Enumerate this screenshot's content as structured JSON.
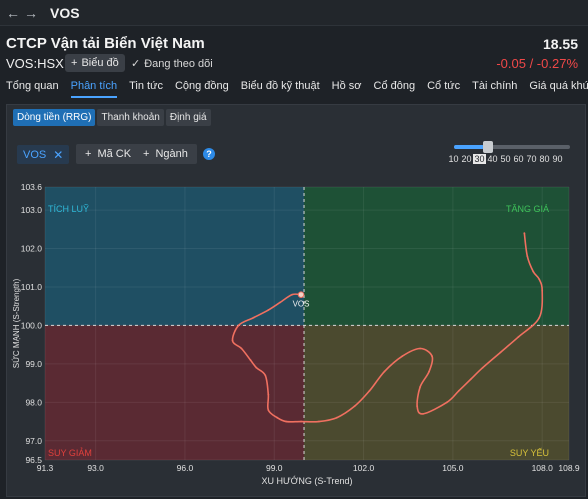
{
  "topbar": {
    "back_icon": "arrow-left-icon",
    "forward_icon": "arrow-right-icon",
    "symbol": "VOS"
  },
  "header": {
    "company": "CTCP Vận tải Biển Việt Nam",
    "price": "18.55",
    "ticker": "VOS:HSX",
    "chart_button": "Biểu đồ",
    "follow_label": "Đang theo dõi",
    "change": "-0.05 / -0.27%",
    "change_color": "#f04848"
  },
  "tabs": [
    "Tổng quan",
    "Phân tích",
    "Tin tức",
    "Cộng đồng",
    "Biểu đồ kỹ thuật",
    "Hồ sơ",
    "Cổ đông",
    "Cổ tức",
    "Tài chính",
    "Giá quá khứ"
  ],
  "active_tab": "Phân tích",
  "subtabs": [
    "Dòng tiền (RRG)",
    "Thanh khoản",
    "Định giá"
  ],
  "active_subtab": "Dòng tiền (RRG)",
  "filters": {
    "chip": "VOS",
    "add_stock": "Mã CK",
    "add_sector": "Ngành",
    "help": "?"
  },
  "period_slider": {
    "options": [
      "10",
      "20",
      "30",
      "40",
      "50",
      "60",
      "70",
      "80",
      "90"
    ],
    "selected": "30"
  },
  "chart_data": {
    "type": "scatter",
    "xlabel": "XU HƯỚNG (S-Trend)",
    "ylabel": "SỨC MẠNH (S-Strength)",
    "xlim": [
      91.3,
      108.9
    ],
    "ylim": [
      96.5,
      103.6
    ],
    "x_ticks": [
      "91.3",
      "93.0",
      "96.0",
      "99.0",
      "102.0",
      "105.0",
      "108.0",
      "108.9"
    ],
    "y_ticks": [
      "103.6",
      "103.0",
      "102.0",
      "101.0",
      "100.0",
      "99.0",
      "98.0",
      "97.0",
      "96.5"
    ],
    "x_tick_values": [
      91.3,
      93.0,
      96.0,
      99.0,
      102.0,
      105.0,
      108.0,
      108.9
    ],
    "y_tick_values": [
      103.6,
      103.0,
      102.0,
      101.0,
      100.0,
      99.0,
      98.0,
      97.0,
      96.5
    ],
    "center": [
      100,
      100
    ],
    "quadrants": {
      "top_left": {
        "label": "TÍCH LUỸ",
        "color": "#1f4f63",
        "label_color": "#2fb8d8"
      },
      "top_right": {
        "label": "TĂNG GIÁ",
        "color": "#1e5136",
        "label_color": "#3ec25a"
      },
      "bottom_left": {
        "label": "SUY GIẢM",
        "color": "#5a2a33",
        "label_color": "#e0403c"
      },
      "bottom_right": {
        "label": "SUY YẾU",
        "color": "#4b4a2f",
        "label_color": "#d8c23a"
      }
    },
    "series": [
      {
        "name": "VOS",
        "color": "#f07060",
        "x": [
          107.4,
          107.5,
          107.7,
          107.9,
          108.0,
          107.9,
          107.2,
          106.6,
          106.0,
          105.6,
          105.2,
          104.8,
          104.0,
          103.8,
          103.9,
          104.2,
          104.3,
          103.9,
          103.3,
          102.7,
          102.2,
          101.7,
          101.1,
          100.5,
          99.9,
          99.4,
          99.1,
          98.8,
          98.8,
          98.7,
          98.4,
          98.2,
          97.9,
          97.6,
          97.8,
          98.3,
          98.8,
          99.2,
          99.6,
          99.9
        ],
        "y": [
          102.4,
          101.8,
          101.4,
          101.2,
          100.9,
          100.2,
          99.7,
          99.3,
          98.9,
          98.6,
          98.3,
          98.0,
          97.7,
          97.9,
          98.4,
          98.8,
          99.2,
          99.4,
          99.2,
          98.8,
          98.3,
          97.9,
          97.6,
          97.5,
          97.5,
          97.5,
          97.6,
          97.8,
          98.2,
          98.7,
          98.9,
          99.1,
          99.4,
          99.6,
          100.0,
          100.2,
          100.4,
          100.6,
          100.8,
          100.8
        ],
        "point_label": "VOS"
      }
    ],
    "grid": true,
    "legend": "none"
  }
}
